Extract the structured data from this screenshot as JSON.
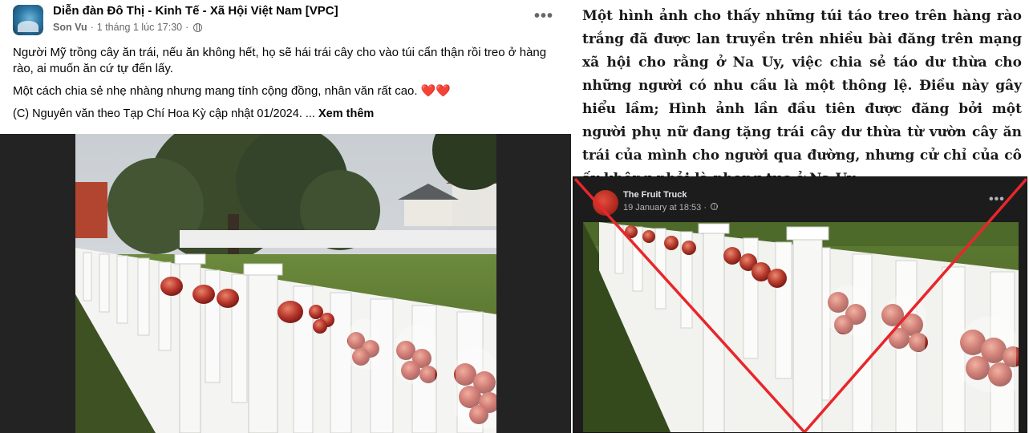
{
  "left_post": {
    "group_name": "Diễn đàn Đô Thị - Kinh Tế - Xã Hội Việt Nam [VPC]",
    "author": "Son Vu",
    "separator": "·",
    "timestamp": "1 tháng 1 lúc 17:30",
    "separator2": "·",
    "more_label": "•••",
    "body": {
      "paragraph1": "Người Mỹ trồng cây ăn trái, nếu ăn không hết, họ sẽ hái trái cây cho vào túi cẩn thận rồi treo ở hàng rào, ai muốn ăn cứ tự đến lấy.",
      "paragraph2": "Một cách chia sẻ nhẹ nhàng nhưng mang tính cộng đồng, nhân văn rất cao.",
      "hearts": "❤️❤️",
      "paragraph3": "(C) Nguyên văn theo Tạp Chí Hoa Kỳ cập nhật 01/2024. ...",
      "see_more": "Xem thêm"
    },
    "photo_icon": "photo-apples-on-white-fence"
  },
  "right_panel": {
    "article_text": "Một hình ảnh cho thấy những túi táo treo trên hàng rào trắng đã được lan truyền trên nhiều bài đăng trên mạng xã hội cho rằng ở Na Uy, việc chia sẻ táo dư thừa cho những người có nhu cầu là một thông lệ. Điều này gây hiểu lầm; Hình ảnh lần đầu tiên được đăng bởi một người phụ nữ đang tặng trái cây dư thừa từ vườn cây ăn trái của mình cho người qua đường, nhưng cử chỉ của cô ấy không phải là phong tục ở Na Uy.",
    "embed": {
      "page_name": "The Fruit Truck",
      "date": "19 January at 18:53",
      "date_sep": "·",
      "more_label": "•••",
      "cross_color": "#e8262b"
    }
  },
  "colors": {
    "text_primary": "#050505",
    "text_secondary": "#65676b",
    "heart": "#e0245e",
    "cross": "#e8262b"
  }
}
